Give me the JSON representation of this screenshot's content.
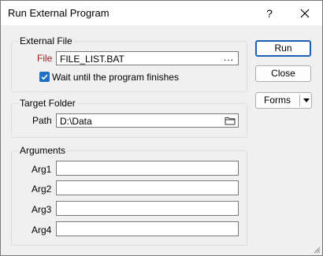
{
  "window": {
    "title": "Run External Program",
    "help_glyph": "?",
    "close_glyph": "✕"
  },
  "external_file": {
    "legend": "External File",
    "file_label": "File",
    "file_value": "FILE_LIST.BAT",
    "browse_glyph": "...",
    "wait_label": "Wait until the program finishes",
    "wait_checked": true
  },
  "target_folder": {
    "legend": "Target Folder",
    "path_label": "Path",
    "path_value": "D:\\Data"
  },
  "arguments": {
    "legend": "Arguments",
    "items": [
      {
        "label": "Arg1",
        "value": ""
      },
      {
        "label": "Arg2",
        "value": ""
      },
      {
        "label": "Arg3",
        "value": ""
      },
      {
        "label": "Arg4",
        "value": ""
      }
    ]
  },
  "buttons": {
    "run": "Run",
    "close": "Close",
    "forms": "Forms"
  },
  "colors": {
    "accent": "#1f6fc5",
    "required_label": "#9b1c1c"
  }
}
